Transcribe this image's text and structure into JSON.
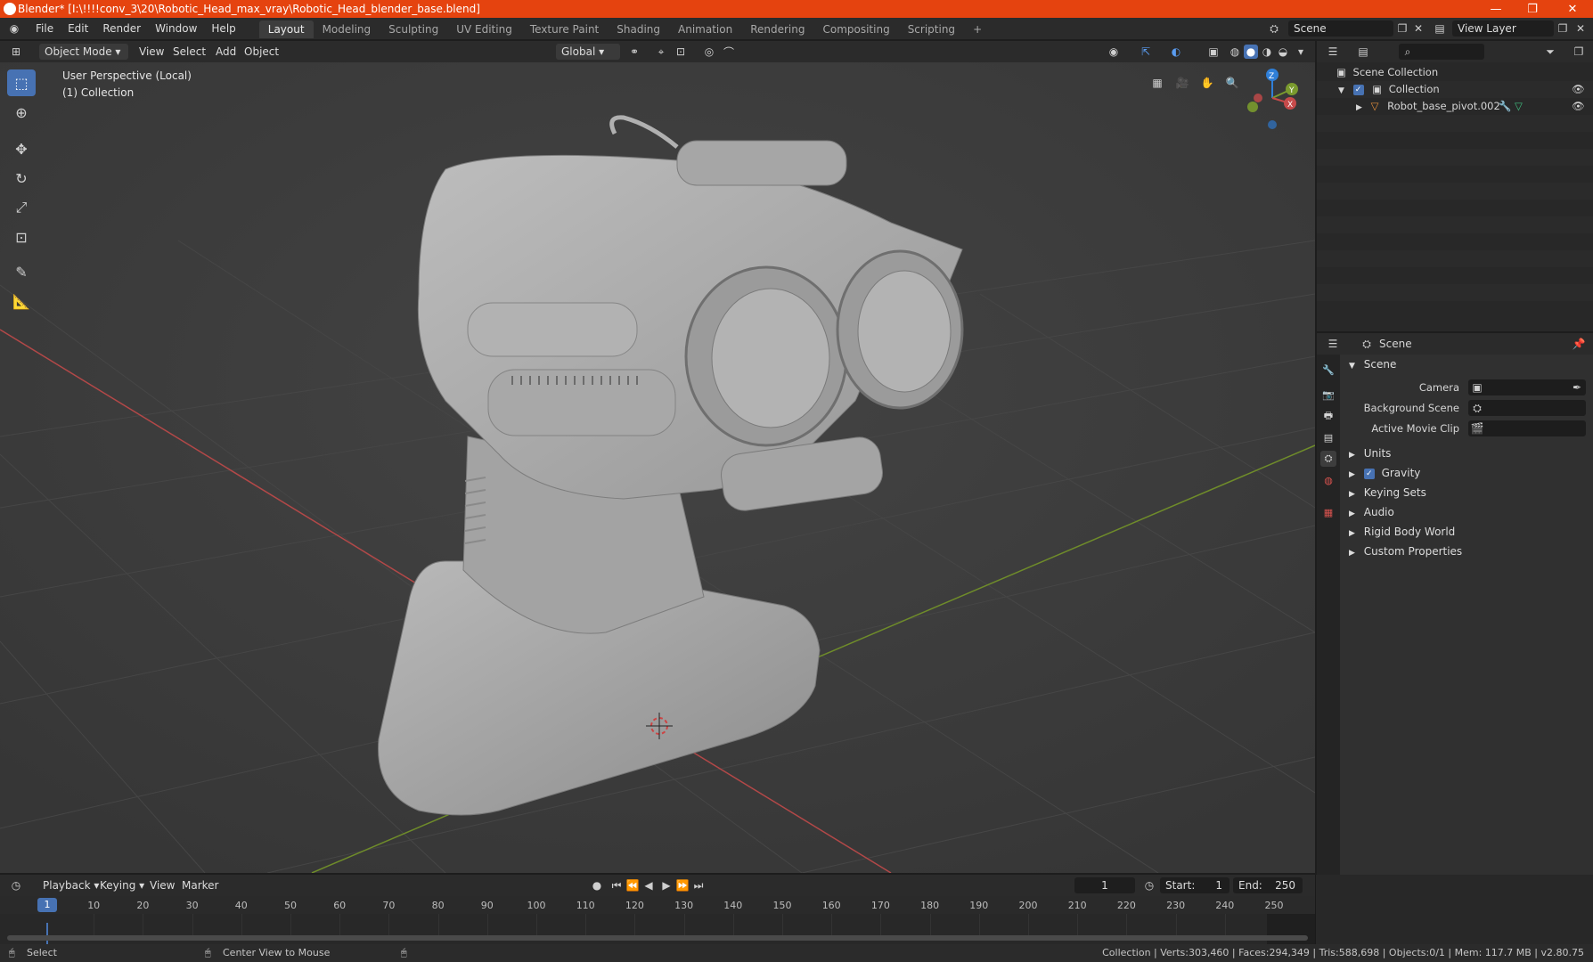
{
  "window": {
    "title": "Blender* [I:\\!!!!conv_3\\20\\Robotic_Head_max_vray\\Robotic_Head_blender_base.blend]",
    "controls": [
      "—",
      "❐",
      "✕"
    ]
  },
  "menu": {
    "items": [
      "File",
      "Edit",
      "Render",
      "Window",
      "Help"
    ],
    "workspaces": [
      "Layout",
      "Modeling",
      "Sculpting",
      "UV Editing",
      "Texture Paint",
      "Shading",
      "Animation",
      "Rendering",
      "Compositing",
      "Scripting"
    ],
    "active_workspace": "Layout",
    "add_tab": "+",
    "scene": "Scene",
    "view_layer": "View Layer"
  },
  "viewport_header": {
    "mode": "Object Mode",
    "menus": [
      "View",
      "Select",
      "Add",
      "Object"
    ],
    "orientation": "Global"
  },
  "viewport": {
    "perspective": "User Perspective (Local)",
    "collection": "(1) Collection",
    "gizmo_axes": [
      "Z",
      "Y",
      "X"
    ],
    "colors": {
      "bg": "#3d3d3d",
      "x_axis": "#c54a4a",
      "y_axis": "#7a9a2e",
      "z_axis": "#2f7fd8"
    }
  },
  "outliner": {
    "root": "Scene Collection",
    "collection": "Collection",
    "object": "Robot_base_pivot.002"
  },
  "properties": {
    "header": "Scene",
    "section": "Scene",
    "fields": [
      {
        "label": "Camera"
      },
      {
        "label": "Background Scene"
      },
      {
        "label": "Active Movie Clip"
      }
    ],
    "panels": [
      "Units",
      "Gravity",
      "Keying Sets",
      "Audio",
      "Rigid Body World",
      "Custom Properties"
    ]
  },
  "timeline": {
    "menus": [
      "Playback",
      "Keying",
      "View",
      "Marker"
    ],
    "current_frame": "1",
    "start_label": "Start:",
    "start": "1",
    "end_label": "End:",
    "end": "250",
    "ticks": [
      "10",
      "20",
      "30",
      "40",
      "50",
      "60",
      "70",
      "80",
      "90",
      "100",
      "110",
      "120",
      "130",
      "140",
      "150",
      "160",
      "170",
      "180",
      "190",
      "200",
      "210",
      "220",
      "230",
      "240",
      "250"
    ],
    "playhead": "1"
  },
  "status": {
    "left": "Select",
    "middle": "Center View to Mouse",
    "right": "Collection | Verts:303,460 | Faces:294,349 | Tris:588,698 | Objects:0/1 | Mem: 117.7 MB | v2.80.75"
  }
}
